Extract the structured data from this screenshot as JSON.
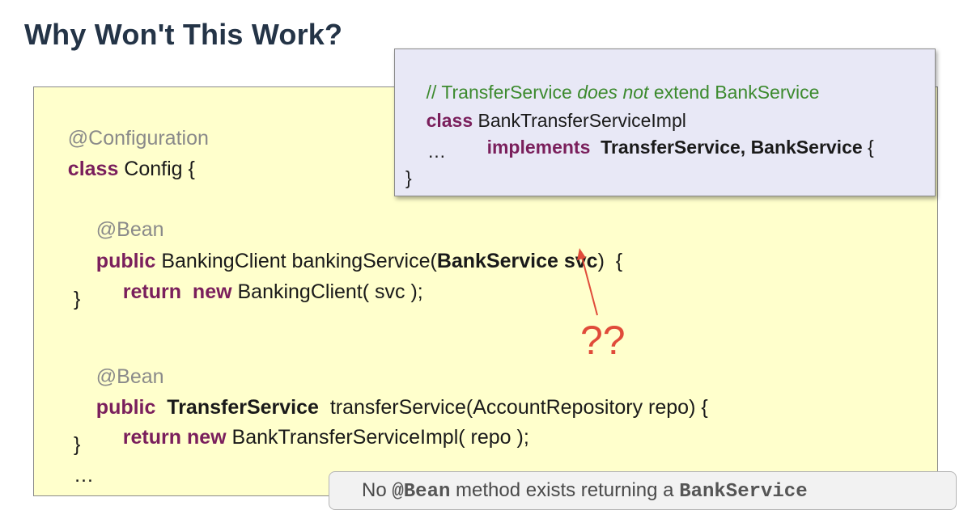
{
  "title": "Why Won't This Work?",
  "config_code": {
    "l1_annotation": "@Configuration",
    "l2_kw": "class",
    "l2_rest": " Config {",
    "l3_annotation": "@Bean",
    "l4_kw": "public",
    "l4_mid": " BankingClient bankingService(",
    "l4_bold": "BankService svc",
    "l4_end": ")  {",
    "l5_kw": "return  new",
    "l5_rest": " BankingClient( svc );",
    "l6": "}",
    "l7_annotation": "@Bean",
    "l8_kw": "public",
    "l8_bold": "  TransferService",
    "l8_rest": "  transferService(AccountRepository repo) {",
    "l9_kw": "return new",
    "l9_rest": " BankTransferServiceImpl( repo );",
    "l10": "}",
    "l11": "…"
  },
  "impl_code": {
    "comment_a": "// TransferService ",
    "comment_em": "does not",
    "comment_b": " extend BankService",
    "l2_kw": "class",
    "l2_rest": " BankTransferServiceImpl",
    "l3_kw": "implements",
    "l3_bold": "  TransferService, BankService",
    "l3_end": " {",
    "l4": "…",
    "l5": "}"
  },
  "question_marks": "??",
  "note": {
    "pre": "No ",
    "code1": "@Bean",
    "mid": " method exists returning a ",
    "code2": "BankService"
  },
  "colors": {
    "title": "#243447",
    "config_bg": "#ffffcc",
    "impl_bg": "#e8e8f6",
    "keyword": "#7a1f5c",
    "comment": "#3c8a2e",
    "arrow": "#e04b3a"
  }
}
